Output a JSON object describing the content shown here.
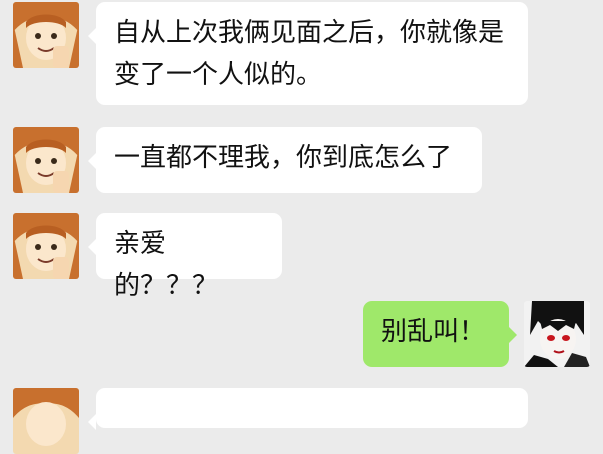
{
  "messages": [
    {
      "text": "自从上次我俩见面之后，你就像是变了一个人似的。",
      "avatar": "girl-avatar"
    },
    {
      "text": "一直都不理我，你到底怎么了",
      "avatar": "girl-avatar"
    },
    {
      "text": "亲爱的？？？",
      "avatar": "girl-avatar"
    },
    {
      "text": "别乱叫！",
      "avatar": "boy-avatar"
    },
    {
      "text": "",
      "avatar": "girl-avatar"
    }
  ],
  "colors": {
    "background": "#ebebeb",
    "bubble_other": "#ffffff",
    "bubble_self": "#9fe86a"
  }
}
